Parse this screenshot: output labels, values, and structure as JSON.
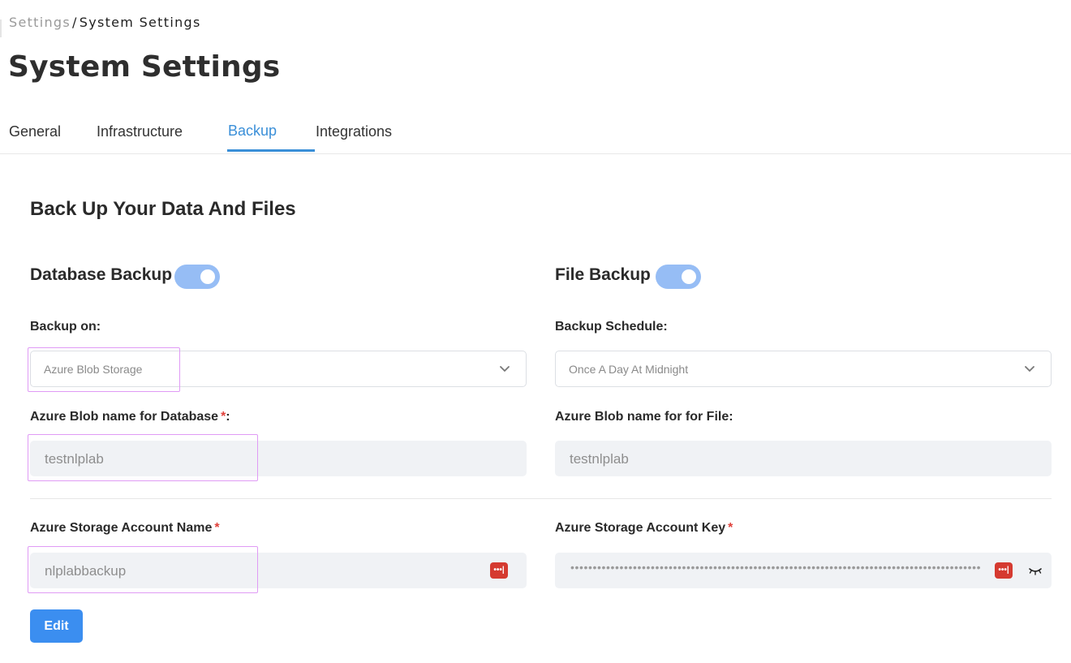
{
  "breadcrumb": {
    "parent": "Settings",
    "separator": "/",
    "current": "System Settings"
  },
  "page_title": "System Settings",
  "tabs": [
    {
      "label": "General",
      "active": false
    },
    {
      "label": "Infrastructure",
      "active": false
    },
    {
      "label": "Backup",
      "active": true
    },
    {
      "label": "Integrations",
      "active": false
    }
  ],
  "section_title": "Back Up Your Data And Files",
  "database_backup": {
    "label": "Database Backup",
    "enabled": true,
    "backup_on": {
      "label": "Backup on:",
      "value": "Azure Blob Storage"
    },
    "blob_name": {
      "label": "Azure Blob name for Database",
      "required_mark": "*",
      "suffix": ":",
      "value": "testnlplab"
    },
    "account_name": {
      "label": "Azure Storage Account Name",
      "required_mark": "*",
      "value": "nlplabbackup"
    }
  },
  "file_backup": {
    "label": "File Backup",
    "enabled": true,
    "schedule": {
      "label": "Backup Schedule:",
      "value": "Once A Day At Midnight"
    },
    "blob_name": {
      "label": "Azure Blob name for for File:",
      "value": "testnlplab"
    },
    "account_key": {
      "label": "Azure Storage Account Key",
      "required_mark": "*",
      "masked_value": "••••••••••••••••••••••••••••••••••••••••••••••••••••••••••••••••••••••••••••••••••••••••••••••"
    }
  },
  "password_manager_icon": "•••|",
  "edit_button": "Edit",
  "colors": {
    "accent": "#3a8fd8",
    "toggle_on": "#96bdf5",
    "button": "#3b8ef0",
    "required": "#e0403a",
    "highlight": "#e09bf5"
  },
  "icons": [
    "chevron-down-icon",
    "password-manager-icon",
    "eye-closed-icon"
  ]
}
